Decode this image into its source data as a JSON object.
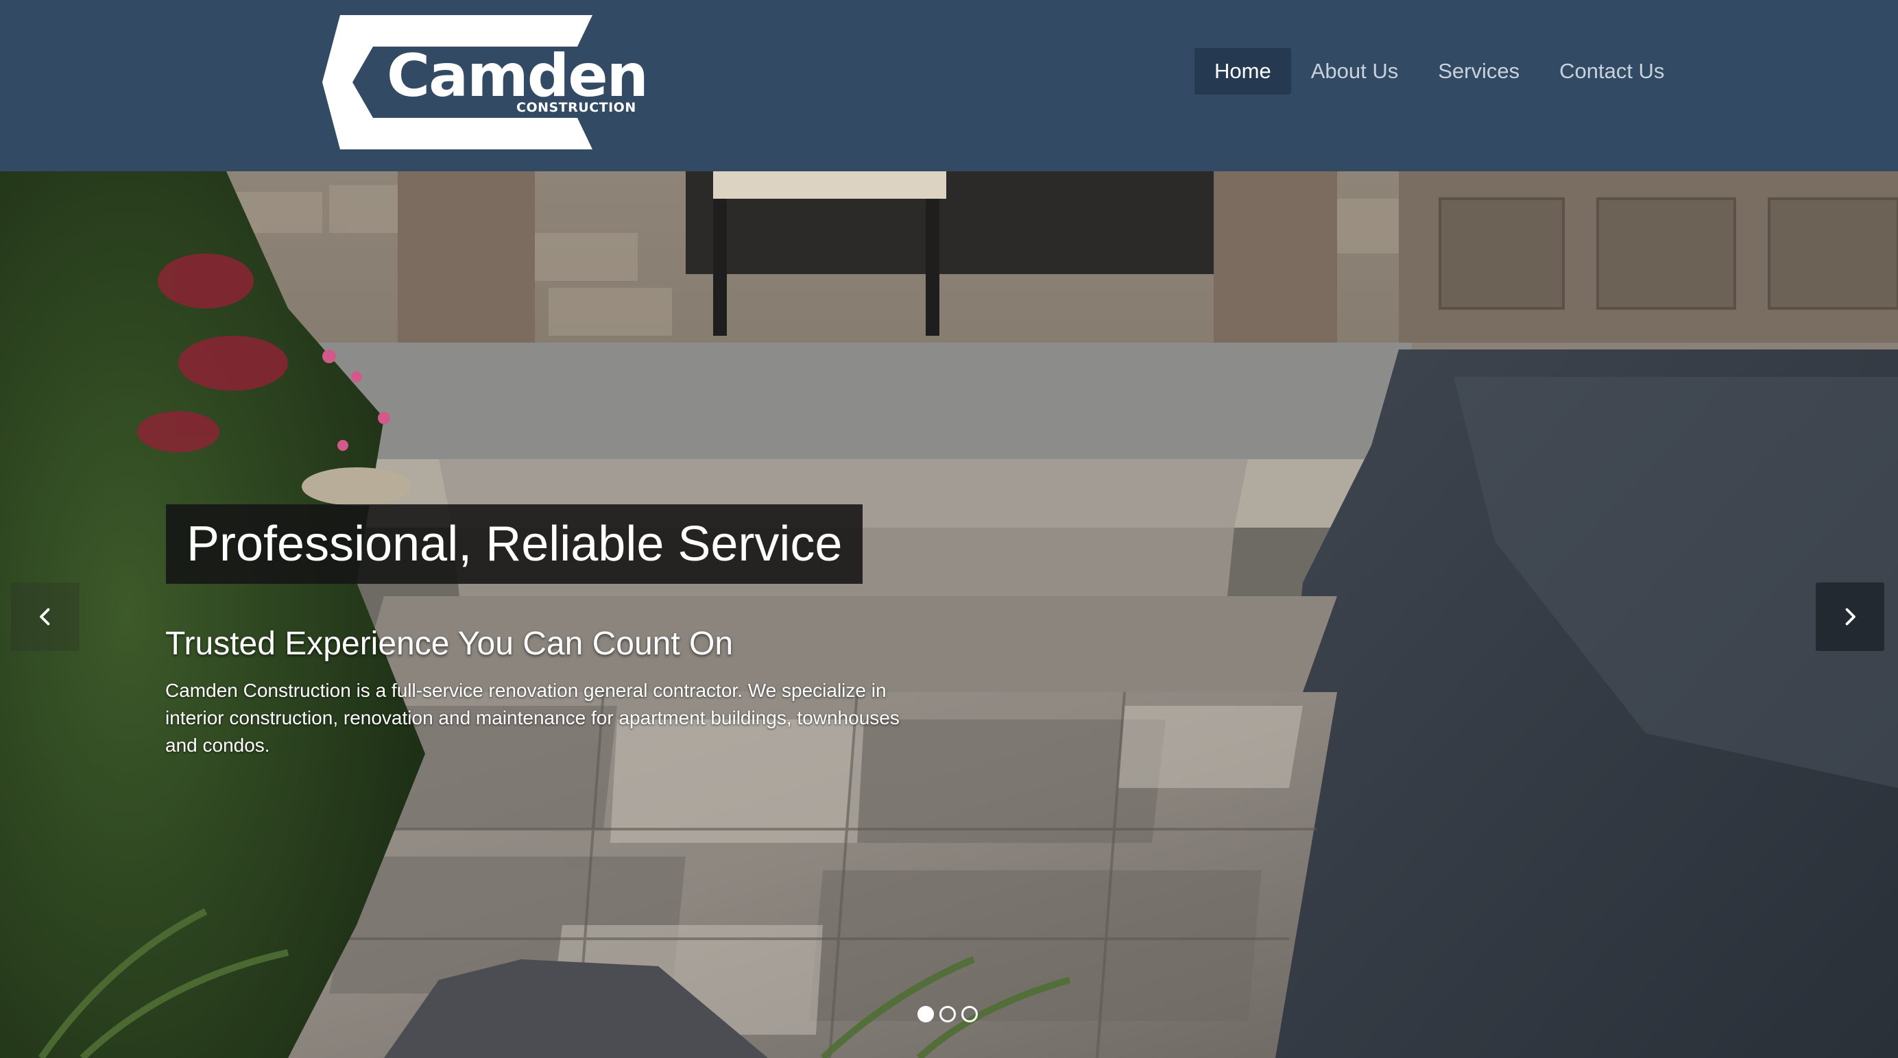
{
  "brand": {
    "name": "Camden",
    "subtitle": "CONSTRUCTION",
    "colors": {
      "header_bg": "#324a64",
      "nav_active_bg": "#253a50",
      "text": "#ffffff"
    }
  },
  "nav": {
    "items": [
      {
        "label": "Home",
        "active": true
      },
      {
        "label": "About Us",
        "active": false
      },
      {
        "label": "Services",
        "active": false
      },
      {
        "label": "Contact Us",
        "active": false
      }
    ]
  },
  "hero": {
    "title": "Professional, Reliable Service",
    "subtitle": "Trusted Experience You Can Count On",
    "body": "Camden Construction is a full-service renovation general contractor. We specialize in interior construction, renovation and maintenance for apartment buildings, townhouses and condos.",
    "prev_icon": "chevron-left-icon",
    "next_icon": "chevron-right-icon",
    "slides": [
      {
        "active": true
      },
      {
        "active": false
      },
      {
        "active": false
      }
    ]
  }
}
